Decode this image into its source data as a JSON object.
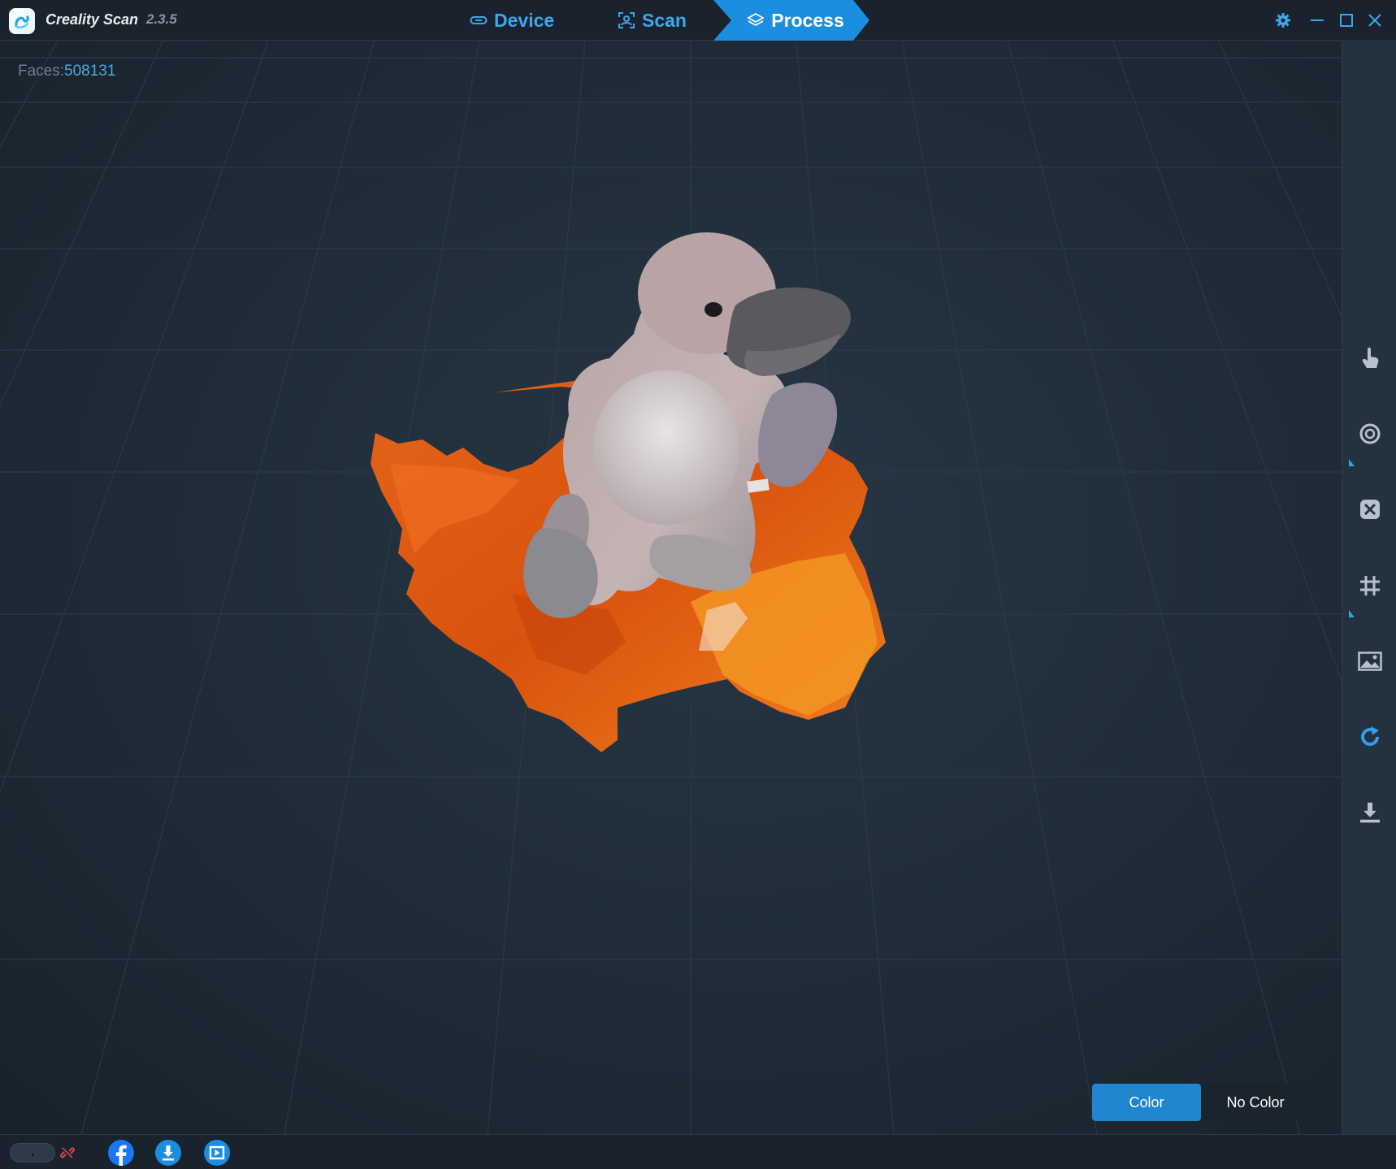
{
  "app": {
    "name": "Creality Scan",
    "version": "2.3.5"
  },
  "nav": {
    "tabs": [
      {
        "label": "Device",
        "icon": "device-icon",
        "active": false
      },
      {
        "label": "Scan",
        "icon": "scan-icon",
        "active": false
      },
      {
        "label": "Process",
        "icon": "layers-icon",
        "active": true
      }
    ]
  },
  "window_controls": [
    "gear-icon",
    "minimize-icon",
    "maximize-icon",
    "close-icon"
  ],
  "viewport": {
    "faces_label": "Faces:",
    "faces_value": "508131",
    "model": "scanned plush platypus on orange base"
  },
  "color_toggle": {
    "color_label": "Color",
    "no_color_label": "No Color",
    "selected": "Color"
  },
  "tool_rail": {
    "tools": [
      "hand-select-icon",
      "lasso-icon",
      "merge-icon",
      "mesh-icon",
      "texture-icon",
      "refresh-icon",
      "export-icon"
    ]
  },
  "status_bar": {
    "icons": [
      "device-connection-icon",
      "unlinked-icon",
      "facebook-icon",
      "download-icon",
      "video-tutorial-icon"
    ]
  },
  "colors": {
    "accent": "#1c8ee0",
    "tab_text": "#3ea7ec",
    "background": "#1e2a36",
    "disconnected": "#e0434a"
  }
}
